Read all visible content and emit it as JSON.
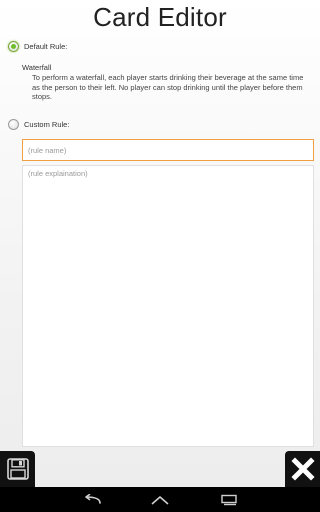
{
  "header": {
    "title": "Card Editor"
  },
  "default_rule": {
    "label": "Default Rule:",
    "selected": true,
    "name": "Waterfall",
    "description": "To perform a waterfall, each player starts drinking their beverage at the same time as the person to their left. No player can stop drinking until the player before them stops."
  },
  "custom_rule": {
    "label": "Custom Rule:",
    "selected": false,
    "name_value": "",
    "name_placeholder": "(rule name)",
    "explanation_value": "",
    "explanation_placeholder": "(rule explaination)"
  },
  "actions": {
    "save_icon": "floppy-disk-icon",
    "close_icon": "close-x-icon"
  },
  "navbar": {
    "back_icon": "back-icon",
    "home_icon": "home-icon",
    "recents_icon": "recent-apps-icon"
  },
  "colors": {
    "accent_focus": "#f0a040",
    "radio_selected": "#6fbf2b",
    "action_bg": "#111111",
    "navbar_bg": "#000000"
  }
}
